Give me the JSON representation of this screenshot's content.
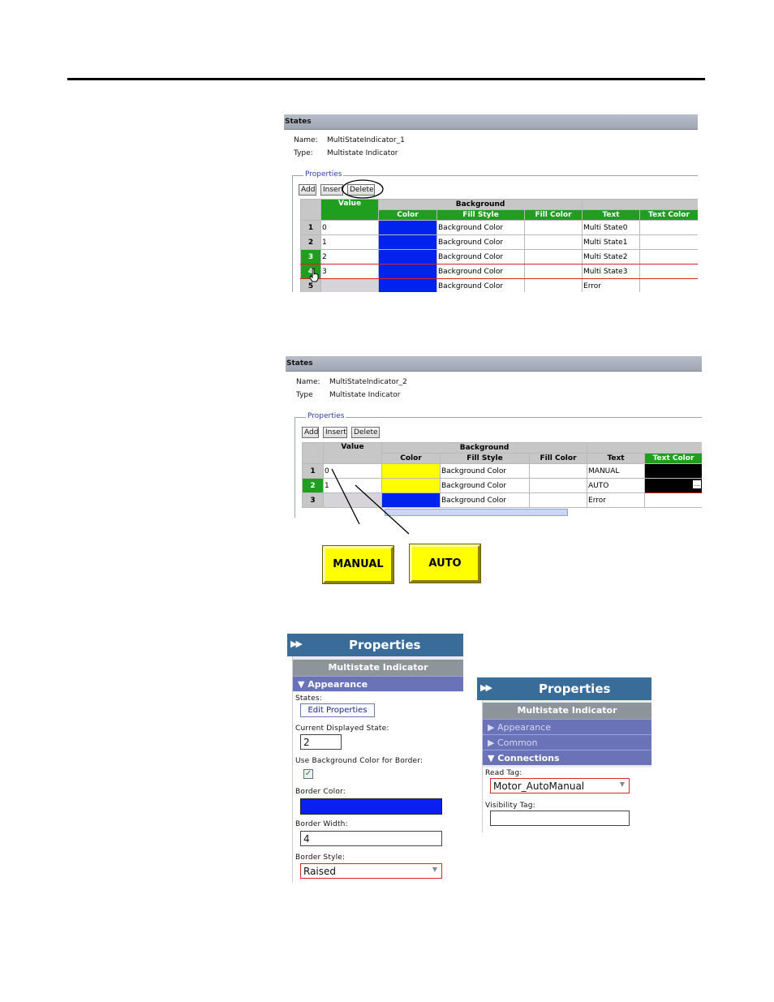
{
  "states1": {
    "title": "States",
    "name_label": "Name:",
    "name_value": "MultiStateIndicator_1",
    "type_label": "Type:",
    "type_value": "Multistate Indicator",
    "properties_legend": "Properties",
    "buttons": {
      "add": "Add",
      "insert": "Insert",
      "delete": "Delete"
    },
    "headers": {
      "value": "Value",
      "background": "Background",
      "color": "Color",
      "fill_style": "Fill Style",
      "fill_color": "Fill Color",
      "text": "Text",
      "text_color": "Text Color"
    },
    "rows": [
      {
        "num": "1",
        "value": "0",
        "fill_style": "Background Color",
        "fill_color": "",
        "text": "Multi State0",
        "text_color": ""
      },
      {
        "num": "2",
        "value": "1",
        "fill_style": "Background Color",
        "fill_color": "",
        "text": "Multi State1",
        "text_color": ""
      },
      {
        "num": "3",
        "value": "2",
        "fill_style": "Background Color",
        "fill_color": "",
        "text": "Multi State2",
        "text_color": ""
      },
      {
        "num": "4",
        "value": "3",
        "fill_style": "Background Color",
        "fill_color": "",
        "text": "Multi State3",
        "text_color": ""
      },
      {
        "num": "5",
        "value": "",
        "fill_style": "Background Color",
        "fill_color": "",
        "text": "Error",
        "text_color": ""
      }
    ]
  },
  "states2": {
    "title": "States",
    "name_label": "Name:",
    "name_value": "MultiStateIndicator_2",
    "type_label": "Type",
    "type_value": "Multistate Indicator",
    "properties_legend": "Properties",
    "buttons": {
      "add": "Add",
      "insert": "Insert",
      "delete": "Delete"
    },
    "headers": {
      "value": "Value",
      "background": "Background",
      "color": "Color",
      "fill_style": "Fill Style",
      "fill_color": "Fill Color",
      "text": "Text",
      "text_color": "Text Color"
    },
    "rows": [
      {
        "num": "1",
        "value": "0",
        "fill_style": "Background Color",
        "fill_color": "",
        "text": "MANUAL",
        "text_color": ""
      },
      {
        "num": "2",
        "value": "1",
        "fill_style": "Background Color",
        "fill_color": "",
        "text": "AUTO",
        "text_color": ""
      },
      {
        "num": "3",
        "value": "",
        "fill_style": "Background Color",
        "fill_color": "",
        "text": "Error",
        "text_color": ""
      }
    ],
    "ellipsis": "..."
  },
  "indicators": {
    "manual": "MANUAL",
    "auto": "AUTO"
  },
  "properties_left": {
    "header": "Properties",
    "group": "Multistate Indicator",
    "section": "Appearance",
    "states_label": "States:",
    "edit_button": "Edit Properties",
    "current_state_label": "Current Displayed State:",
    "current_state_value": "2",
    "use_bg_label": "Use Background Color for Border:",
    "use_bg_checked": true,
    "border_color_label": "Border Color:",
    "border_color": "#0a1ff2",
    "border_width_label": "Border Width:",
    "border_width_value": "4",
    "border_style_label": "Border Style:",
    "border_style_value": "Raised"
  },
  "properties_right": {
    "header": "Properties",
    "group": "Multistate Indicator",
    "sections": [
      "Appearance",
      "Common",
      "Connections"
    ],
    "read_tag_label": "Read Tag:",
    "read_tag_value": "Motor_AutoManual",
    "visibility_tag_label": "Visibility Tag:",
    "visibility_tag_value": ""
  },
  "colors": {
    "blue_swatch": "#0022ee",
    "yellow_swatch": "#ffff00",
    "green_header": "#1f9e1f",
    "panel_blue": "#3a6c9a"
  }
}
